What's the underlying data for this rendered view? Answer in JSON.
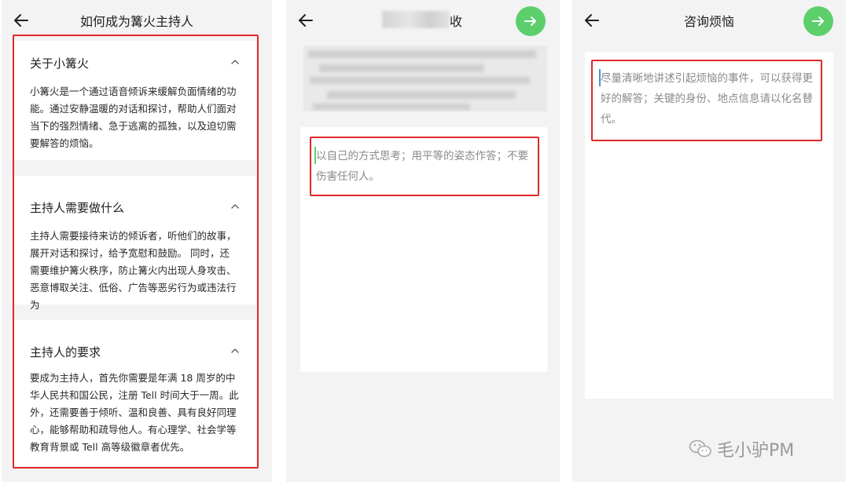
{
  "panel_about": {
    "title": "如何成为篝火主持人",
    "sections": [
      {
        "title": "关于小篝火",
        "body": "小篝火是一个通过语音倾诉来缓解负面情绪的功能。通过安静温暖的对话和探讨，帮助人们面对当下的强烈情绪、急于逃离的孤独，以及迫切需要解答的烦恼。"
      },
      {
        "title": "主持人需要做什么",
        "body": "主持人需要接待来访的倾诉者，听他们的故事，展开对话和探讨，给予宽慰和鼓励。 同时，还需要维护篝火秩序，防止篝火内出现人身攻击、恶意博取关注、低俗、广告等恶劣行为或违法行为"
      },
      {
        "title": "主持人的要求",
        "body": "要成为主持人，首先你需要是年满 18 周岁的中华人民共和国公民，注册 Tell 时间大于一周。此外，还需要善于倾听、温和良善、具有良好同理心，能够帮助和疏导他人。有心理学、社会学等教育背景或 Tell 高等级徽章者优先。"
      }
    ]
  },
  "panel_reply": {
    "title_suffix": "收",
    "input_text": "以自己的方式思考；用平等的姿态作答；不要伤害任何人。"
  },
  "panel_consult": {
    "title": "咨询烦恼",
    "input_text": "尽量清晰地讲述引起烦恼的事件，可以获得更好的解答；关键的身份、地点信息请以化名替代。"
  },
  "watermark": {
    "text": "毛小驴PM"
  },
  "colors": {
    "accent_green": "#5ccf6c",
    "highlight_red": "#e0282b",
    "panel_bg": "#f3f3f3",
    "caret_blue": "#4a90e2"
  },
  "icons": [
    "back-arrow-icon",
    "send-arrow-icon",
    "chevron-up-icon",
    "wechat-icon"
  ]
}
